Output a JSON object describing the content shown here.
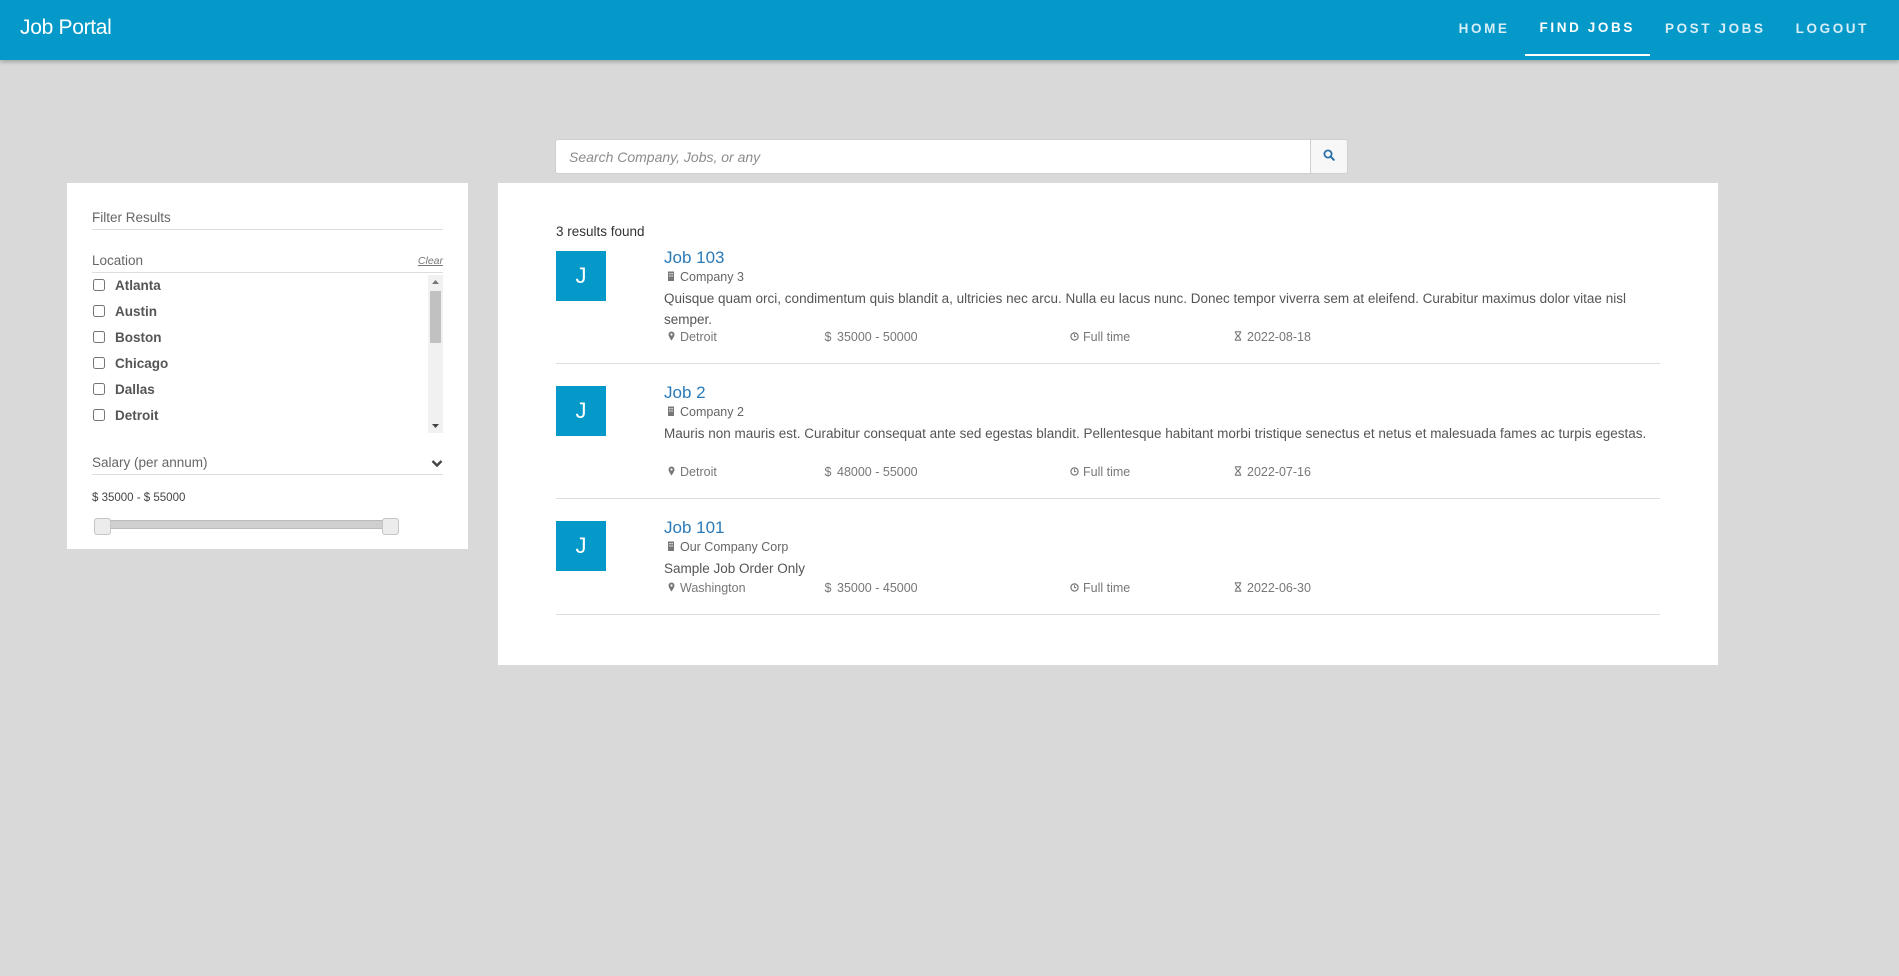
{
  "app": {
    "brand": "Job Portal"
  },
  "nav": [
    {
      "label": "HOME",
      "active": false
    },
    {
      "label": "FIND JOBS",
      "active": true
    },
    {
      "label": "POST JOBS",
      "active": false
    },
    {
      "label": "LOGOUT",
      "active": false
    }
  ],
  "search": {
    "placeholder": "Search Company, Jobs, or any",
    "value": ""
  },
  "filter": {
    "title": "Filter Results",
    "location": {
      "label": "Location",
      "clear_label": "Clear",
      "options": [
        "Atlanta",
        "Austin",
        "Boston",
        "Chicago",
        "Dallas",
        "Detroit"
      ]
    },
    "salary": {
      "label": "Salary (per annum)",
      "range_text": "$ 35000 - $ 55000",
      "min_fraction": 0.0,
      "max_fraction": 1.0
    }
  },
  "results": {
    "count_text": "3 results found",
    "jobs": [
      {
        "initial": "J",
        "title": "Job 103",
        "company": "Company 3",
        "description": "Quisque quam orci, condimentum quis blandit a, ultricies nec arcu. Nulla eu lacus nunc. Donec tempor viverra sem at eleifend. Curabitur maximus dolor vitae nisl semper.",
        "location": "Detroit",
        "salary": "35000 - 50000",
        "type": "Full time",
        "date": "2022-08-18"
      },
      {
        "initial": "J",
        "title": "Job 2",
        "company": "Company 2",
        "description": "Mauris non mauris est. Curabitur consequat ante sed egestas blandit. Pellentesque habitant morbi tristique senectus et netus et malesuada fames ac turpis egestas.",
        "location": "Detroit",
        "salary": "48000 - 55000",
        "type": "Full time",
        "date": "2022-07-16"
      },
      {
        "initial": "J",
        "title": "Job 101",
        "company": "Our Company Corp",
        "description": "Sample Job Order Only",
        "location": "Washington",
        "salary": "35000 - 45000",
        "type": "Full time",
        "date": "2022-06-30"
      }
    ]
  },
  "colors": {
    "primary": "#0499c8",
    "link": "#2a7ab8",
    "background": "#d9d9d9"
  },
  "icons": {
    "search": "search-icon",
    "company": "building-icon",
    "location": "map-marker-icon",
    "salary": "dollar-icon",
    "type": "clock-icon",
    "date": "hourglass-icon",
    "salary_toggle": "chevron-down-icon"
  }
}
